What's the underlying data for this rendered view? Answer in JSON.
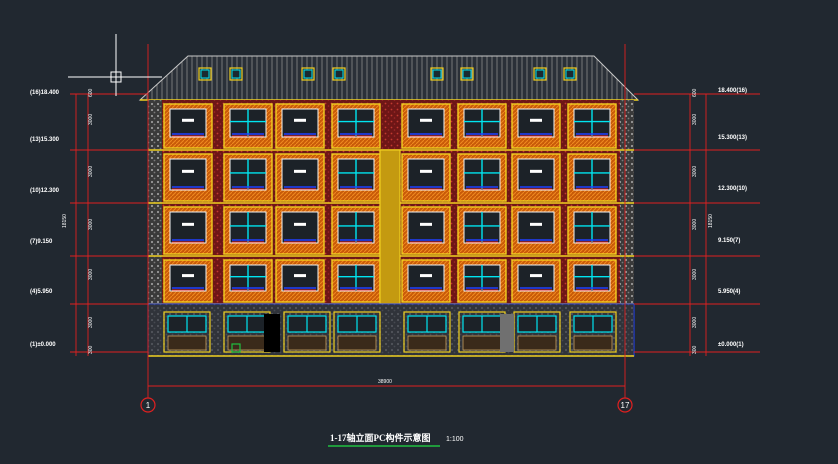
{
  "window": {
    "background": "#212830"
  },
  "drawing": {
    "title": "1-17轴立面PC构件示意图",
    "scale": "1:100",
    "overall_dimension": "38900",
    "grid_axes": [
      "1",
      "17"
    ],
    "left_levels": [
      "(16)18.400",
      "(13)15.300",
      "(10)12.300",
      "(7)9.150",
      "(4)5.950",
      "(1)±0.000"
    ],
    "right_levels": [
      "18.400(16)",
      "15.300(13)",
      "12.300(10)",
      "9.150(7)",
      "5.950(4)",
      "±0.000(1)"
    ],
    "left_segments": [
      "600",
      "3000",
      "3000",
      "3000",
      "3000",
      "3000",
      "300"
    ],
    "left_total": "18150",
    "right_segments": [
      "600",
      "3000",
      "3000",
      "3000",
      "3000",
      "3000",
      "300"
    ],
    "right_total": "18150"
  },
  "colors": {
    "brick": "#8a1e1e",
    "frame_yellow": "#f0d020",
    "orange": "#e07010",
    "cyan": "#00e5f0",
    "red_line": "#e02020",
    "blue": "#2040ff",
    "green": "#20c040",
    "grey": "#b0b0b0"
  }
}
